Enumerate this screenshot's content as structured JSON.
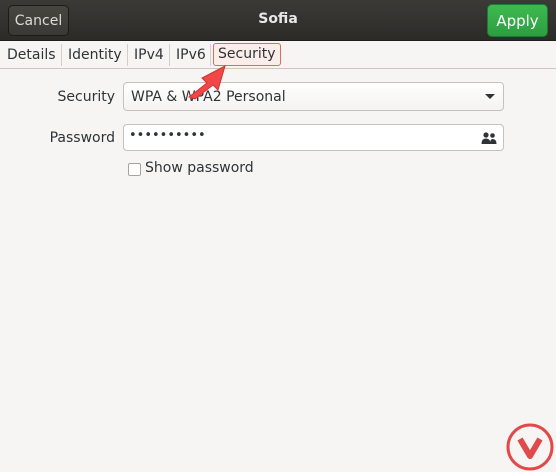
{
  "header": {
    "cancel_label": "Cancel",
    "title": "Sofia",
    "apply_label": "Apply"
  },
  "tabs": [
    {
      "label": "Details",
      "active": false
    },
    {
      "label": "Identity",
      "active": false
    },
    {
      "label": "IPv4",
      "active": false
    },
    {
      "label": "IPv6",
      "active": false
    },
    {
      "label": "Security",
      "active": true
    }
  ],
  "form": {
    "security_label": "Security",
    "security_value": "WPA & WPA2 Personal",
    "password_label": "Password",
    "password_value": "••••••••••",
    "show_password_label": "Show password",
    "show_password_checked": false
  },
  "icons": {
    "combo_arrow": "chevron-down-icon",
    "password_option": "people-icon",
    "annotation": "red-arrow-icon",
    "watermark": "logo-icon"
  },
  "colors": {
    "accent_apply": "#2e9d41",
    "annotation": "#f04848",
    "watermark": "#e04a4a"
  }
}
